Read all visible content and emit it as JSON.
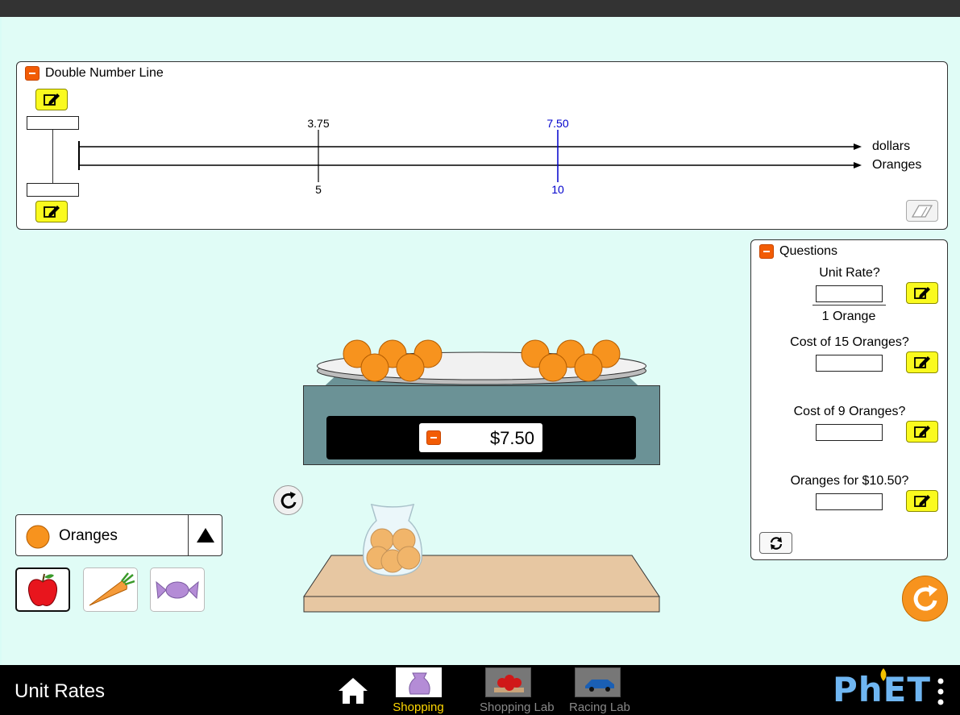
{
  "app": {
    "title": "Unit Rates"
  },
  "double_number_line": {
    "title": "Double Number Line",
    "top_axis_label": "dollars",
    "bottom_axis_label": "Oranges",
    "markers": [
      {
        "top": "3.75",
        "bottom": "5",
        "color": "#000000"
      },
      {
        "top": "7.50",
        "bottom": "10",
        "color": "#0000cc"
      }
    ]
  },
  "questions": {
    "title": "Questions",
    "unit_rate_label": "Unit Rate?",
    "unit_rate_denominator": "1 Orange",
    "items": [
      {
        "label": "Cost of 15 Oranges?"
      },
      {
        "label": "Cost of 9 Oranges?"
      },
      {
        "label": "Oranges for $10.50?"
      }
    ]
  },
  "scale": {
    "price": "$7.50"
  },
  "item_selector": {
    "selected": "Oranges",
    "options": [
      "apple",
      "carrot",
      "candy"
    ]
  },
  "navigation": {
    "screens": [
      {
        "label": "Shopping",
        "active": true
      },
      {
        "label": "Shopping Lab",
        "active": false
      },
      {
        "label": "Racing Lab",
        "active": false
      }
    ],
    "brand": "PhET"
  },
  "colors": {
    "background": "#e0fcf6",
    "edit_button": "#fafa1e",
    "collapse_button": "#f25c05",
    "orange_fruit": "#f7931e",
    "reset_all": "#f7931e",
    "active_screen": "#ffd700",
    "blue_marker": "#0000cc"
  }
}
